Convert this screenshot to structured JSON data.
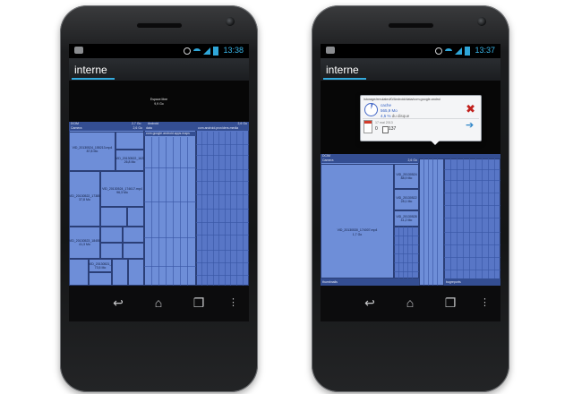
{
  "screens": [
    {
      "status_time": "13:38",
      "title": "interne",
      "free_space": {
        "label": "Espace libre",
        "size": "9,9 Go"
      },
      "header": {
        "left": "DCIM",
        "right": "2,7 Go",
        "mid_right": "Android",
        "mid_size": "2,6 Go"
      },
      "camera_label": "Camera",
      "camera_size": "2,6 Go",
      "data_label": "data",
      "files": [
        {
          "name": "VID_20130524_155213.mp4",
          "size": "87,8 Mo"
        },
        {
          "name": "VID_20130522_162246.mp4",
          "size": "26,8 Mo"
        },
        {
          "name": "VID_20130524_174617.mp4",
          "size": "96,3 Mo"
        },
        {
          "name": "VID_20130522_173851",
          "size": "37,8 Mo"
        },
        {
          "name": "VID_20130523_184553",
          "size": "41,3 Mo"
        },
        {
          "name": "VID_20130521_193055",
          "size": "73,5 Mo"
        }
      ],
      "android_package": "com.android.providers.media",
      "google_package": "com.google.android.apps.maps"
    },
    {
      "status_time": "13:37",
      "title": "interne",
      "free_space": {
        "label": "Espace libre",
        "size": "9,9 Go"
      },
      "dcim_label": "DCIM",
      "camera_label": "Camera",
      "camera_size": "2,6 Go",
      "big_file": {
        "name": "VID_20130530_174007.mp4",
        "size": "1,7 Go"
      },
      "files": [
        {
          "name": "VID_20130524",
          "size": "88,9 Mo"
        },
        {
          "name": "VID_20130522",
          "size": "28,1 Mo"
        },
        {
          "name": "VID_20130528",
          "size": "41,2 Mo"
        }
      ],
      "bottom_left": "thumbnails",
      "bottom_right": "bugreports",
      "popup": {
        "path": "/storage/emulated/0/Android/data/com.google.androi",
        "name": "cache",
        "size": "565,9 Mo",
        "percent": "4,5 %",
        "percent_suffix": "du disque",
        "date": "17 mai 2013",
        "folders": "0",
        "files": "137"
      }
    }
  ]
}
